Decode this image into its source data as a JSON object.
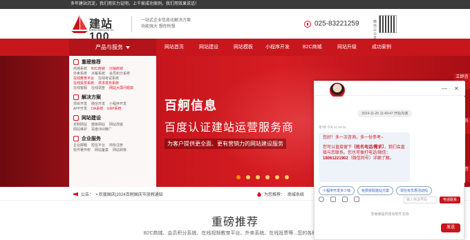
{
  "topbar": {
    "text": "多年建站沉淀，我们用实力证明，上千家成功案例，我们用效果说话！"
  },
  "header": {
    "brand": "建站100",
    "url": "www.web100.cc",
    "slogan_line1": "一站式企业信息化解决方案",
    "slogan_line2": "功能强大 想你所想",
    "phone": "025-83221259",
    "wechat_label": "微信公众号"
  },
  "nav": {
    "category_label": "产品与服务",
    "items": [
      "网站首页",
      "网站建设",
      "网站模板",
      "小程序开发",
      "B2C商城",
      "网站升级",
      "成功案例"
    ]
  },
  "menu": {
    "sections": [
      {
        "title": "重磅推荐",
        "rows": [
          [
            "商城系统",
            "B2C商城",
            "分销商城"
          ],
          [
            "外卖系统",
            "点餐系统",
            "会员积分系统"
          ],
          [
            "在线教育平台",
            "在线考试系统"
          ],
          [
            "在线投票系统",
            "供求发布系统"
          ],
          [
            "在线客服",
            "在线调查",
            "网站大屏问题搞"
          ]
        ]
      },
      {
        "title": "解决方案",
        "rows": [
          [
            "项目开发",
            "微信开发",
            "小程序开发"
          ],
          [
            "APP开发",
            "OA系统",
            "ERP系统"
          ]
        ]
      },
      {
        "title": "网站建设",
        "rows": [
          [
            "定制网站",
            "模板网站",
            "网站改版"
          ],
          [
            "网站维护",
            "百度/360推广"
          ]
        ]
      },
      {
        "title": "企业服务",
        "rows": [
          [
            "企业邮箱",
            "短信平台",
            "商标注册"
          ],
          [
            "软件著作权",
            "网站备案",
            "网站转移"
          ]
        ]
      }
    ]
  },
  "banner": {
    "title": "百舸信息",
    "subtitle": "百度认证建站运营服务商",
    "tagline": "为客户提供更全面、更有营销力的网站建设服务"
  },
  "notice": {
    "label_a": "公告：",
    "text_a": "• 欢度国庆|2024百舸国庆节放假通知",
    "label_b": "为您推荐：",
    "text_b": "商城系统"
  },
  "section": {
    "title": "重磅推荐",
    "subtitle": "B2C商城、会员积分系统、在线视频教育平台、外卖系统、在线投票等...您的各种系统"
  },
  "side_tabs": [
    "立即咨询",
    "咨询热线",
    "微信咨询"
  ],
  "chat": {
    "min_icon": "—",
    "close_icon": "✕",
    "date": "2024-11-26 11:49:47 开始沟通",
    "agent_line": "南*网 今天 11:49:32",
    "msg_line1": "您好！多一次咨询，多一份参考~",
    "msg_line2a": "您可以直接留下【",
    "msg_bold": "姓名电话/需求",
    "msg_line2b": "】，我们会直接与您联系。您也可拨打电话/微信：",
    "msg_phone": "18061221902",
    "msg_line2c": "（微信同号）详细了解。",
    "chips": [
      "小程序开发多少钱",
      "免费获取建站方案",
      "现在有优惠活动吗"
    ],
    "input_placeholder": "输入电话号码",
    "contact_button": "电话联系",
    "powered": "爱番番提供咨询软件支持",
    "send_button": "发送"
  }
}
